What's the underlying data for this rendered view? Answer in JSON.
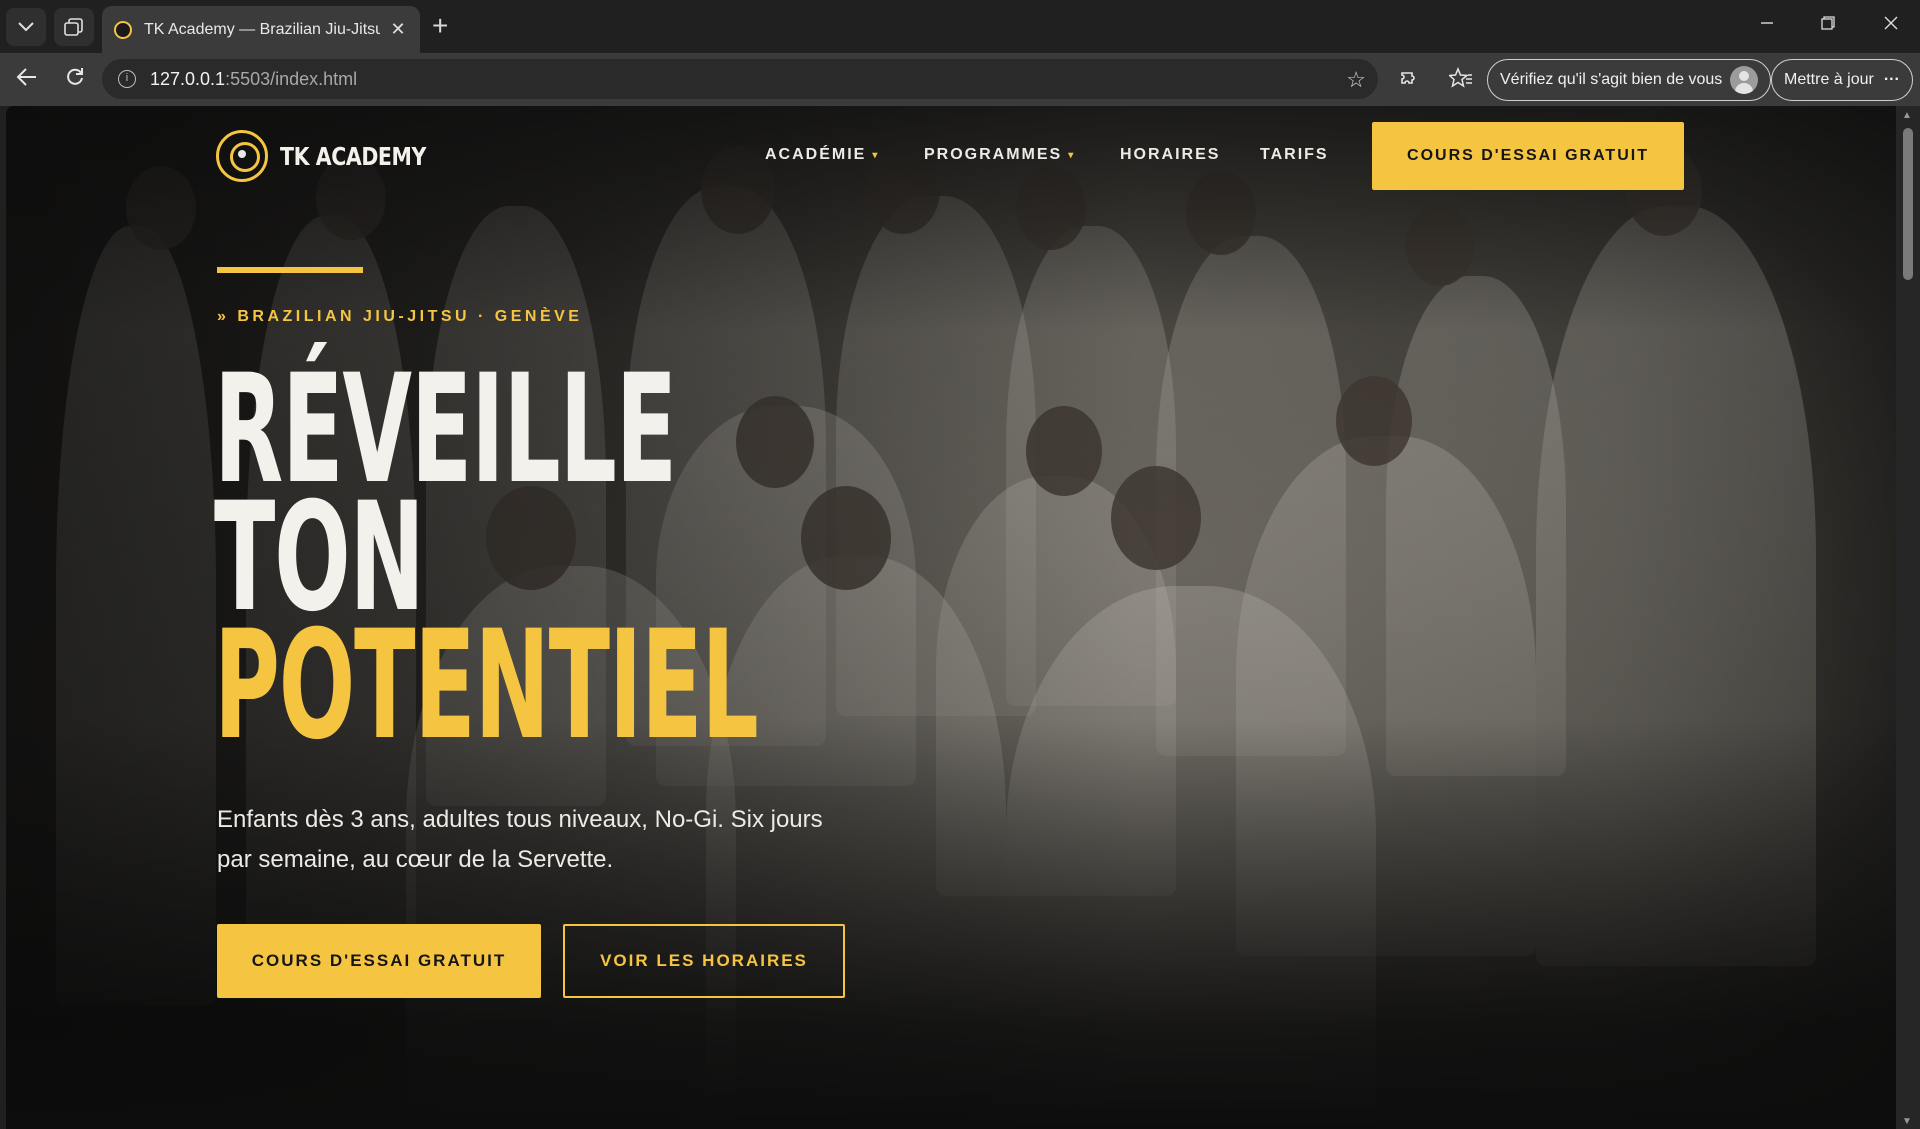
{
  "browser": {
    "tab_title": "TK Academy — Brazilian Jiu-Jitsu Genève",
    "url_host": "127.0.0.1",
    "url_rest": ":5503/index.html",
    "profile_pill": "Vérifiez qu'il s'agit bien de vous",
    "update_pill": "Mettre à jour",
    "new_tab": "+",
    "tab_close": "✕",
    "more": "···"
  },
  "header": {
    "logo_text": "TK ACADEMY",
    "nav": [
      {
        "label": "ACADÉMIE",
        "dropdown": true
      },
      {
        "label": "PROGRAMMES",
        "dropdown": true
      },
      {
        "label": "HORAIRES",
        "dropdown": false
      },
      {
        "label": "TARIFS",
        "dropdown": false
      }
    ],
    "caret": "▾",
    "cta": "COURS D'ESSAI GRATUIT"
  },
  "hero": {
    "kicker": "» BRAZILIAN JIU-JITSU · GENÈVE",
    "headline": [
      "RÉVEILLE",
      "TON",
      "POTENTIEL"
    ],
    "lede": "Enfants dès 3 ans, adultes tous niveaux, No-Gi. Six jours par semaine, au cœur de la Servette.",
    "primary_cta": "COURS D'ESSAI GRATUIT",
    "secondary_cta": "VOIR LES HORAIRES"
  },
  "colors": {
    "accent": "#f5c542",
    "text_light": "#f3f1ec",
    "chrome_bg": "#202020"
  }
}
